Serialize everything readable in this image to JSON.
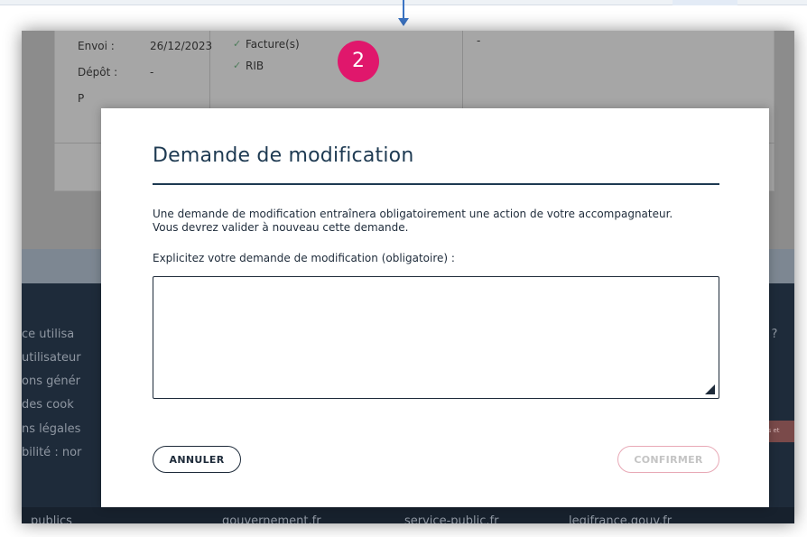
{
  "background_page": {
    "envoi_label": "Envoi :",
    "envoi_value": "26/12/2023",
    "depot_label": "Dépôt :",
    "depot_value": "-",
    "p_fragment": "P",
    "doc_items": [
      "Facture(s)",
      "RIB"
    ],
    "right_value": "-",
    "footer_links": [
      "ce utilisa",
      "utilisateur",
      "ons génér",
      "des cook",
      "ns légales",
      "bilité : nor"
    ],
    "footer_right": "les ?",
    "footer_badge": "ements et",
    "gov_links": [
      "publics",
      "gouvernement.fr",
      "service-public.fr",
      "legifrance.gouv.fr"
    ]
  },
  "badge": {
    "number": "2",
    "color": "#e0176c"
  },
  "modal": {
    "title": "Demande de modification",
    "description": "Une demande de modification entraînera obligatoirement une action de votre accompagnateur. Vous devrez valider à nouveau cette demande.",
    "field_label": "Explicitez votre demande de modification (obligatoire) :",
    "textarea_value": "",
    "cancel_label": "ANNULER",
    "confirm_label": "CONFIRMER"
  },
  "colors": {
    "primary": "#1e3a52",
    "accent_disabled_border": "#e8a9b6",
    "footer_bg": "#1e2b3a",
    "arrow": "#3b74c4"
  }
}
